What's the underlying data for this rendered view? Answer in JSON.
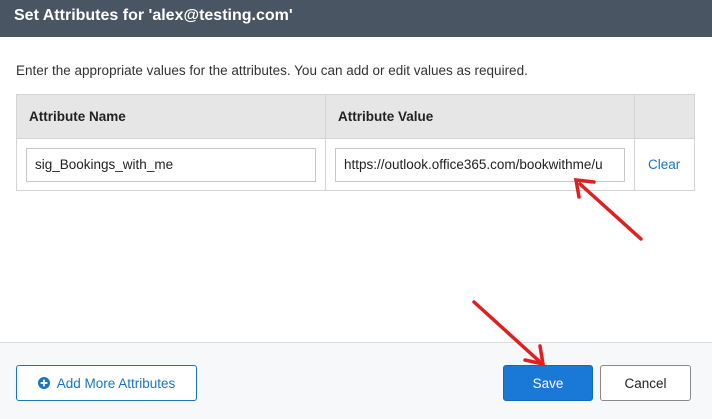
{
  "dialog": {
    "title": "Set Attributes for 'alex@testing.com'",
    "instructions": "Enter the appropriate values for the attributes. You can add or edit values as required."
  },
  "table": {
    "headers": {
      "name": "Attribute Name",
      "value": "Attribute Value",
      "action": ""
    },
    "rows": [
      {
        "name": "sig_Bookings_with_me",
        "value": "https://outlook.office365.com/bookwithme/u",
        "action": "Clear"
      }
    ]
  },
  "footer": {
    "add_label": "Add More Attributes",
    "save_label": "Save",
    "cancel_label": "Cancel"
  },
  "colors": {
    "titlebar": "#4a5563",
    "accent": "#1a78d6",
    "link": "#1b74c4",
    "annotation_arrow": "#e02020"
  },
  "icons": {
    "add_button": "plus-circle-icon"
  }
}
